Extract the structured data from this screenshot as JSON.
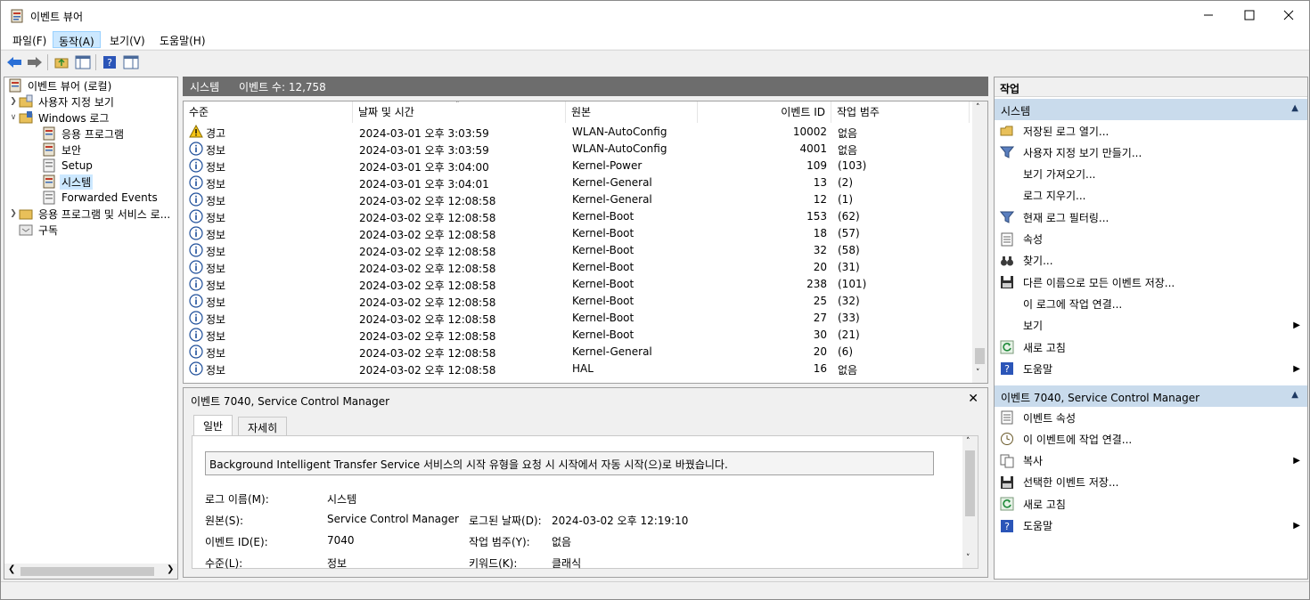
{
  "window": {
    "title": "이벤트 뷰어"
  },
  "menu": [
    "파일(F)",
    "동작(A)",
    "보기(V)",
    "도움말(H)"
  ],
  "tree": {
    "root": "이벤트 뷰어 (로컬)",
    "custom_views": "사용자 지정 보기",
    "windows_logs": "Windows 로그",
    "logs": [
      "응용 프로그램",
      "보안",
      "Setup",
      "시스템",
      "Forwarded Events"
    ],
    "apps_services": "응용 프로그램 및 서비스 로...",
    "subscriptions": "구독"
  },
  "center": {
    "log_name": "시스템",
    "event_count": "이벤트 수: 12,758",
    "columns": [
      "수준",
      "날짜 및 시간",
      "원본",
      "이벤트 ID",
      "작업 범주"
    ],
    "rows": [
      {
        "level": "경고",
        "type": "warning",
        "datetime": "2024-03-01 오후 3:03:59",
        "source": "WLAN-AutoConfig",
        "id": "10002",
        "category": "없음"
      },
      {
        "level": "정보",
        "type": "info",
        "datetime": "2024-03-01 오후 3:03:59",
        "source": "WLAN-AutoConfig",
        "id": "4001",
        "category": "없음"
      },
      {
        "level": "정보",
        "type": "info",
        "datetime": "2024-03-01 오후 3:04:00",
        "source": "Kernel-Power",
        "id": "109",
        "category": "(103)"
      },
      {
        "level": "정보",
        "type": "info",
        "datetime": "2024-03-01 오후 3:04:01",
        "source": "Kernel-General",
        "id": "13",
        "category": "(2)"
      },
      {
        "level": "정보",
        "type": "info",
        "datetime": "2024-03-02 오후 12:08:58",
        "source": "Kernel-General",
        "id": "12",
        "category": "(1)"
      },
      {
        "level": "정보",
        "type": "info",
        "datetime": "2024-03-02 오후 12:08:58",
        "source": "Kernel-Boot",
        "id": "153",
        "category": "(62)"
      },
      {
        "level": "정보",
        "type": "info",
        "datetime": "2024-03-02 오후 12:08:58",
        "source": "Kernel-Boot",
        "id": "18",
        "category": "(57)"
      },
      {
        "level": "정보",
        "type": "info",
        "datetime": "2024-03-02 오후 12:08:58",
        "source": "Kernel-Boot",
        "id": "32",
        "category": "(58)"
      },
      {
        "level": "정보",
        "type": "info",
        "datetime": "2024-03-02 오후 12:08:58",
        "source": "Kernel-Boot",
        "id": "20",
        "category": "(31)"
      },
      {
        "level": "정보",
        "type": "info",
        "datetime": "2024-03-02 오후 12:08:58",
        "source": "Kernel-Boot",
        "id": "238",
        "category": "(101)"
      },
      {
        "level": "정보",
        "type": "info",
        "datetime": "2024-03-02 오후 12:08:58",
        "source": "Kernel-Boot",
        "id": "25",
        "category": "(32)"
      },
      {
        "level": "정보",
        "type": "info",
        "datetime": "2024-03-02 오후 12:08:58",
        "source": "Kernel-Boot",
        "id": "27",
        "category": "(33)"
      },
      {
        "level": "정보",
        "type": "info",
        "datetime": "2024-03-02 오후 12:08:58",
        "source": "Kernel-Boot",
        "id": "30",
        "category": "(21)"
      },
      {
        "level": "정보",
        "type": "info",
        "datetime": "2024-03-02 오후 12:08:58",
        "source": "Kernel-General",
        "id": "20",
        "category": "(6)"
      },
      {
        "level": "정보",
        "type": "info",
        "datetime": "2024-03-02 오후 12:08:58",
        "source": "HAL",
        "id": "16",
        "category": "없음"
      }
    ]
  },
  "detail": {
    "title": "이벤트 7040, Service Control Manager",
    "tabs": [
      "일반",
      "자세히"
    ],
    "description": "Background Intelligent Transfer Service 서비스의 시작 유형을 요청 시 시작에서 자동 시작(으)로 바꿨습니다.",
    "fields": {
      "log_name_label": "로그 이름(M):",
      "log_name": "시스템",
      "source_label": "원본(S):",
      "source": "Service Control Manager",
      "logged_label": "로그된 날짜(D):",
      "logged": "2024-03-02 오후 12:19:10",
      "event_id_label": "이벤트 ID(E):",
      "event_id": "7040",
      "task_label": "작업 범주(Y):",
      "task": "없음",
      "level_label": "수준(L):",
      "level": "정보",
      "keywords_label": "키워드(K):",
      "keywords": "클래식"
    }
  },
  "actions": {
    "title": "작업",
    "section1": "시스템",
    "items1": [
      {
        "label": "저장된 로그 열기...",
        "icon": "folder-open-icon"
      },
      {
        "label": "사용자 지정 보기 만들기...",
        "icon": "filter-icon"
      },
      {
        "label": "보기 가져오기...",
        "icon": ""
      },
      {
        "label": "로그 지우기...",
        "icon": ""
      },
      {
        "label": "현재 로그 필터링...",
        "icon": "filter-icon"
      },
      {
        "label": "속성",
        "icon": "properties-icon"
      },
      {
        "label": "찾기...",
        "icon": "binoculars-icon"
      },
      {
        "label": "다른 이름으로 모든 이벤트 저장...",
        "icon": "save-icon"
      },
      {
        "label": "이 로그에 작업 연결...",
        "icon": ""
      },
      {
        "label": "보기",
        "icon": "",
        "submenu": true
      },
      {
        "label": "새로 고침",
        "icon": "refresh-icon"
      },
      {
        "label": "도움말",
        "icon": "help-icon",
        "submenu": true
      }
    ],
    "section2": "이벤트 7040, Service Control Manager",
    "items2": [
      {
        "label": "이벤트 속성",
        "icon": "properties-icon"
      },
      {
        "label": "이 이벤트에 작업 연결...",
        "icon": "clock-icon"
      },
      {
        "label": "복사",
        "icon": "copy-icon",
        "submenu": true
      },
      {
        "label": "선택한 이벤트 저장...",
        "icon": "save-icon"
      },
      {
        "label": "새로 고침",
        "icon": "refresh-icon"
      },
      {
        "label": "도움말",
        "icon": "help-icon",
        "submenu": true
      }
    ]
  }
}
